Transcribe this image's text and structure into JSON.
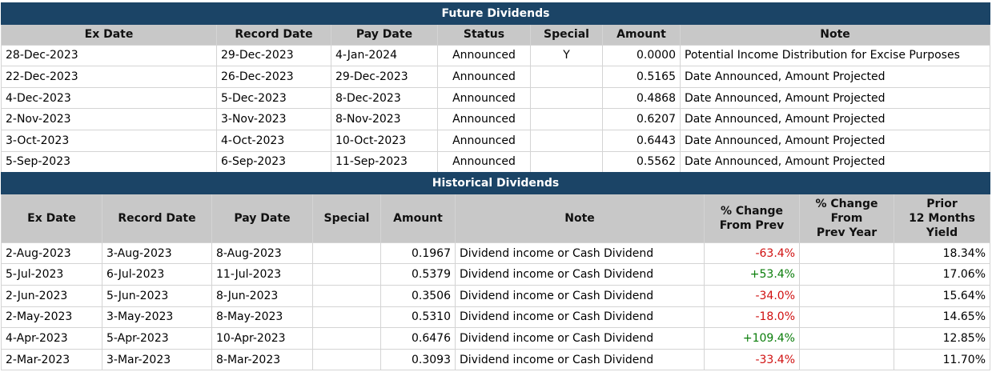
{
  "future": {
    "title": "Future Dividends",
    "headers": [
      "Ex Date",
      "Record Date",
      "Pay Date",
      "Status",
      "Special",
      "Amount",
      "Note"
    ],
    "rows": [
      {
        "ex": "28-Dec-2023",
        "record": "29-Dec-2023",
        "pay": "4-Jan-2024",
        "status": "Announced",
        "special": "Y",
        "amount": "0.0000",
        "note": "Potential Income Distribution for Excise Purposes"
      },
      {
        "ex": "22-Dec-2023",
        "record": "26-Dec-2023",
        "pay": "29-Dec-2023",
        "status": "Announced",
        "special": "",
        "amount": "0.5165",
        "note": "Date Announced, Amount Projected"
      },
      {
        "ex": "4-Dec-2023",
        "record": "5-Dec-2023",
        "pay": "8-Dec-2023",
        "status": "Announced",
        "special": "",
        "amount": "0.4868",
        "note": "Date Announced, Amount Projected"
      },
      {
        "ex": "2-Nov-2023",
        "record": "3-Nov-2023",
        "pay": "8-Nov-2023",
        "status": "Announced",
        "special": "",
        "amount": "0.6207",
        "note": "Date Announced, Amount Projected"
      },
      {
        "ex": "3-Oct-2023",
        "record": "4-Oct-2023",
        "pay": "10-Oct-2023",
        "status": "Announced",
        "special": "",
        "amount": "0.6443",
        "note": "Date Announced, Amount Projected"
      },
      {
        "ex": "5-Sep-2023",
        "record": "6-Sep-2023",
        "pay": "11-Sep-2023",
        "status": "Announced",
        "special": "",
        "amount": "0.5562",
        "note": "Date Announced, Amount Projected"
      }
    ]
  },
  "historical": {
    "title": "Historical Dividends",
    "headers": [
      "Ex Date",
      "Record Date",
      "Pay Date",
      "Special",
      "Amount",
      "Note",
      "% Change\nFrom Prev",
      "% Change\nFrom\nPrev Year",
      "Prior\n12 Months\nYield"
    ],
    "rows": [
      {
        "ex": "2-Aug-2023",
        "record": "3-Aug-2023",
        "pay": "8-Aug-2023",
        "special": "",
        "amount": "0.1967",
        "note": "Dividend income or Cash Dividend",
        "chg_prev": "-63.4%",
        "chg_year": "",
        "yield": "18.34%"
      },
      {
        "ex": "5-Jul-2023",
        "record": "6-Jul-2023",
        "pay": "11-Jul-2023",
        "special": "",
        "amount": "0.5379",
        "note": "Dividend income or Cash Dividend",
        "chg_prev": "+53.4%",
        "chg_year": "",
        "yield": "17.06%"
      },
      {
        "ex": "2-Jun-2023",
        "record": "5-Jun-2023",
        "pay": "8-Jun-2023",
        "special": "",
        "amount": "0.3506",
        "note": "Dividend income or Cash Dividend",
        "chg_prev": "-34.0%",
        "chg_year": "",
        "yield": "15.64%"
      },
      {
        "ex": "2-May-2023",
        "record": "3-May-2023",
        "pay": "8-May-2023",
        "special": "",
        "amount": "0.5310",
        "note": "Dividend income or Cash Dividend",
        "chg_prev": "-18.0%",
        "chg_year": "",
        "yield": "14.65%"
      },
      {
        "ex": "4-Apr-2023",
        "record": "5-Apr-2023",
        "pay": "10-Apr-2023",
        "special": "",
        "amount": "0.6476",
        "note": "Dividend income or Cash Dividend",
        "chg_prev": "+109.4%",
        "chg_year": "",
        "yield": "12.85%"
      },
      {
        "ex": "2-Mar-2023",
        "record": "3-Mar-2023",
        "pay": "8-Mar-2023",
        "special": "",
        "amount": "0.3093",
        "note": "Dividend income or Cash Dividend",
        "chg_prev": "-33.4%",
        "chg_year": "",
        "yield": "11.70%"
      }
    ]
  },
  "colors": {
    "title_bar": "#1b4466",
    "header_bg": "#c8c8c8",
    "negative": "#d01010",
    "positive": "#0a7d0a"
  }
}
